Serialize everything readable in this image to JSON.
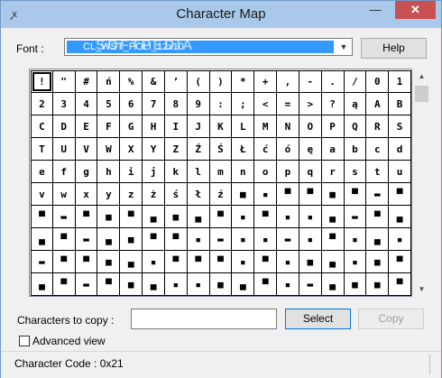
{
  "window": {
    "title": "Character Map",
    "min_glyph": "—",
    "max_glyph": "☐",
    "close_glyph": "✕",
    "app_icon_glyph": "ꭙ"
  },
  "font": {
    "label": "Font :",
    "value": "CL_WST_POLI_12x10"
  },
  "watermark": "SOFTPEDIA",
  "help_label": "Help",
  "char_grid": {
    "rows": [
      [
        "!",
        "\"",
        "#",
        "ń",
        "%",
        "&",
        "’",
        "(",
        ")",
        "*",
        "+",
        ",",
        "-",
        ".",
        "/",
        "0",
        "1"
      ],
      [
        "2",
        "3",
        "4",
        "5",
        "6",
        "7",
        "8",
        "9",
        ":",
        ";",
        "<",
        "=",
        ">",
        "?",
        "ą",
        "A",
        "B"
      ],
      [
        "C",
        "D",
        "E",
        "F",
        "G",
        "H",
        "I",
        "J",
        "K",
        "L",
        "M",
        "N",
        "O",
        "P",
        "Q",
        "R",
        "S"
      ],
      [
        "T",
        "U",
        "V",
        "W",
        "X",
        "Y",
        "Z",
        "Ź",
        "Ś",
        "Ł",
        "ć",
        "ó",
        "ę",
        "a",
        "b",
        "c",
        "d"
      ],
      [
        "e",
        "f",
        "g",
        "h",
        "i",
        "j",
        "k",
        "l",
        "m",
        "n",
        "o",
        "p",
        "q",
        "r",
        "s",
        "t",
        "u"
      ],
      [
        "v",
        "w",
        "x",
        "y",
        "z",
        "ż",
        "ś",
        "ł",
        "ź",
        "■",
        "▪",
        "▀",
        "▀",
        "■",
        "▀",
        "▬",
        "▀"
      ],
      [
        "▀",
        "▬",
        "▀",
        "■",
        "▀",
        "▄",
        "■",
        "▄",
        "▀",
        "▪",
        "▀",
        "▪",
        "▪",
        "▄",
        "▬",
        "▀",
        "▄"
      ],
      [
        "▄",
        "▀",
        "▬",
        "▄",
        "■",
        "▀",
        "▀",
        "▪",
        "▬",
        "▪",
        "▪",
        "▬",
        "▪",
        "▀",
        "▪",
        "▄",
        "▪"
      ],
      [
        "▬",
        "▀",
        "▀",
        "■",
        "▄",
        "▪",
        "▀",
        "▀",
        "▀",
        "▪",
        "▀",
        "▪",
        "■",
        "▄",
        "▪",
        "■",
        "▀"
      ],
      [
        "▄",
        "▀",
        "▬",
        "▀",
        "■",
        "▄",
        "▪",
        "▪",
        "■",
        "▄",
        "▀",
        "▪",
        "▬",
        "▄",
        "■",
        "■",
        "▀"
      ]
    ]
  },
  "scrollbar": {
    "up_glyph": "▲",
    "down_glyph": "▼"
  },
  "copy": {
    "label": "Characters to copy :",
    "value": "",
    "select_label": "Select",
    "copy_label": "Copy"
  },
  "advanced": {
    "label": "Advanced view",
    "checked": false
  },
  "status": {
    "text": "Character Code : 0x21"
  }
}
